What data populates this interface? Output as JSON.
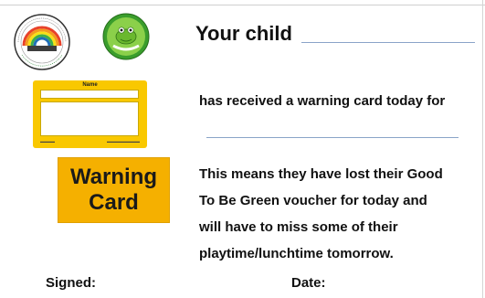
{
  "header": {
    "your_child_label": "Your child"
  },
  "logos": {
    "school_logo": {
      "icon": "rainbow-school-logo-icon",
      "colors": [
        "#e8422a",
        "#f49a1d",
        "#f7e017",
        "#3fae49",
        "#1f6fb8"
      ]
    },
    "green_logo": {
      "icon": "good-to-be-green-frog-logo-icon",
      "color": "#3a9d2c"
    }
  },
  "mini_card": {
    "name_label": "Name",
    "color": "#f9c800"
  },
  "warning_card": {
    "line1": "Warning",
    "line2": "Card",
    "color": "#f5b000"
  },
  "body": {
    "received_text": "has received a warning card today for",
    "means_line1": "This means they have lost their Good",
    "means_line2": "To Be Green voucher for today and",
    "means_line3": "will have to miss some of their",
    "means_line4": "playtime/lunchtime tomorrow."
  },
  "footer": {
    "signed_label": "Signed:",
    "date_label": "Date:"
  }
}
